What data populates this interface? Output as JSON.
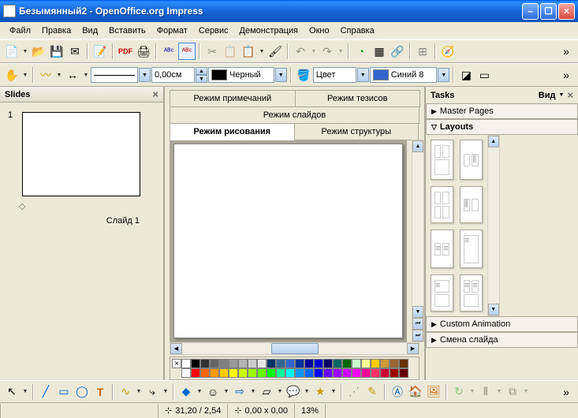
{
  "title": "Безымянный2 - OpenOffice.org Impress",
  "menu": [
    "Файл",
    "Правка",
    "Вид",
    "Вставить",
    "Формат",
    "Сервис",
    "Демонстрация",
    "Окно",
    "Справка"
  ],
  "line_width": "0,00см",
  "line_color_label": "Черный",
  "fill_type": "Цвет",
  "fill_color": "Синий 8",
  "fill_color_hex": "#3366cc",
  "slides": {
    "panel_title": "Slides",
    "items": [
      {
        "num": "1",
        "label": "Слайд 1"
      }
    ]
  },
  "view_tabs": {
    "notes": "Режим примечаний",
    "outline_top": "Режим тезисов",
    "slides": "Режим слайдов",
    "drawing": "Режим рисования",
    "structure": "Режим структуры"
  },
  "tasks": {
    "panel_title": "Tasks",
    "view_label": "Вид",
    "sections": {
      "master": "Master Pages",
      "layouts": "Layouts",
      "custom_anim": "Custom Animation",
      "slide_change": "Смена слайда"
    }
  },
  "palette_colors": [
    [
      "#ffffff",
      "#000000",
      "#333333",
      "#666666",
      "#808080",
      "#999999",
      "#b2b2b2",
      "#cccccc",
      "#e5e5e5",
      "#003366",
      "#336699",
      "#3366cc",
      "#003399",
      "#000099",
      "#0000cc",
      "#000066",
      "#006666",
      "#006600",
      "#ccffcc",
      "#ffff99",
      "#ffcc00",
      "#cc9933",
      "#996633",
      "#663300"
    ],
    [
      "#ffffff",
      "#ff0000",
      "#ff6600",
      "#ff9900",
      "#ffcc00",
      "#ffff00",
      "#ccff00",
      "#99ff00",
      "#66ff00",
      "#00ff00",
      "#00ff99",
      "#00ffff",
      "#0099ff",
      "#0066ff",
      "#0000ff",
      "#6600ff",
      "#9900ff",
      "#cc00ff",
      "#ff00ff",
      "#ff0099",
      "#ff3366",
      "#cc0033",
      "#990000",
      "#660000"
    ]
  ],
  "status": {
    "pos": "31,20 / 2,54",
    "size": "0,00 x 0,00",
    "zoom": "13%"
  }
}
